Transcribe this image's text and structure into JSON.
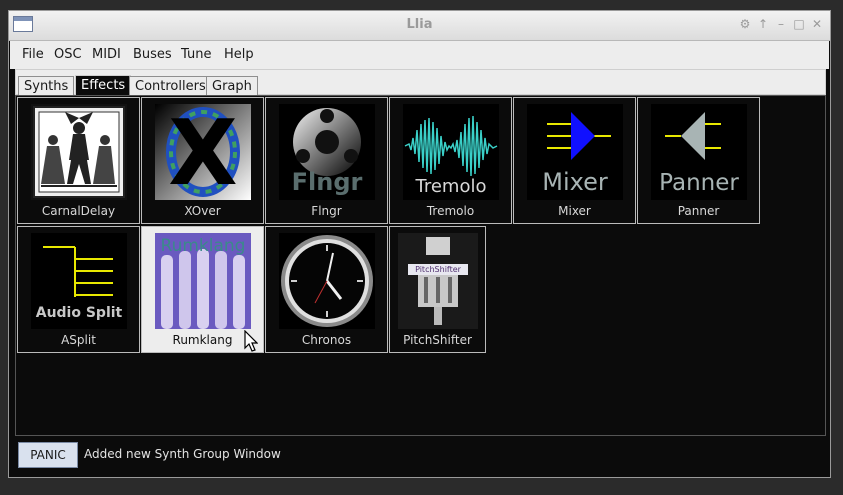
{
  "window": {
    "title": "Llia"
  },
  "menubar": {
    "items": [
      "File",
      "OSC",
      "MIDI",
      "Buses",
      "Tune",
      "Help"
    ]
  },
  "tabs": [
    {
      "label": "Synths",
      "active": false
    },
    {
      "label": "Effects",
      "active": true
    },
    {
      "label": "Controllers",
      "active": false
    },
    {
      "label": "Graph",
      "active": false
    }
  ],
  "effects": [
    {
      "name": "CarnalDelay",
      "thumb_text": ""
    },
    {
      "name": "XOver",
      "thumb_text": "X"
    },
    {
      "name": "Flngr",
      "thumb_text": "Flngr"
    },
    {
      "name": "Tremolo",
      "thumb_text": "Tremolo"
    },
    {
      "name": "Mixer",
      "thumb_text": "Mixer"
    },
    {
      "name": "Panner",
      "thumb_text": "Panner"
    },
    {
      "name": "ASplit",
      "thumb_text": "Audio Split"
    },
    {
      "name": "Rumklang",
      "thumb_text": "Rumklang"
    },
    {
      "name": "Chronos",
      "thumb_text": ""
    },
    {
      "name": "PitchShifter",
      "thumb_text": "PitchShifter"
    }
  ],
  "statusbar": {
    "panic_label": "PANIC",
    "message": "Added new Synth Group Window"
  },
  "colors": {
    "background": "#0b0b0b",
    "accent_blue": "#1010ff",
    "accent_yellow": "#e8e800",
    "panner_gray": "#a8b4b4",
    "tremolo_teal": "#3ad0c8"
  }
}
